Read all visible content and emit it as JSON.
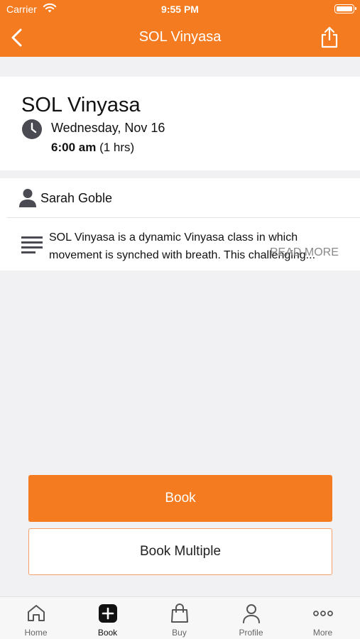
{
  "status_bar": {
    "carrier": "Carrier",
    "time": "9:55 PM"
  },
  "navbar": {
    "title": "SOL Vinyasa"
  },
  "class": {
    "title": "SOL Vinyasa",
    "date": "Wednesday, Nov 16",
    "start_time": "6:00 am",
    "duration": "(1 hrs)",
    "instructor": "Sarah Goble",
    "description": "SOL Vinyasa is a dynamic Vinyasa class in which movement is synched with breath. This challenging...",
    "read_more": "READ MORE"
  },
  "actions": {
    "book": "Book",
    "book_multiple": "Book Multiple"
  },
  "tabbar": {
    "items": [
      {
        "label": "Home",
        "icon": "home-icon"
      },
      {
        "label": "Book",
        "icon": "book-plus-icon"
      },
      {
        "label": "Buy",
        "icon": "shopping-bag-icon"
      },
      {
        "label": "Profile",
        "icon": "profile-icon"
      },
      {
        "label": "More",
        "icon": "more-dots-icon"
      }
    ],
    "active": "Book"
  },
  "colors": {
    "accent": "#f47b20",
    "background": "#f1f1f3",
    "card": "#ffffff"
  }
}
